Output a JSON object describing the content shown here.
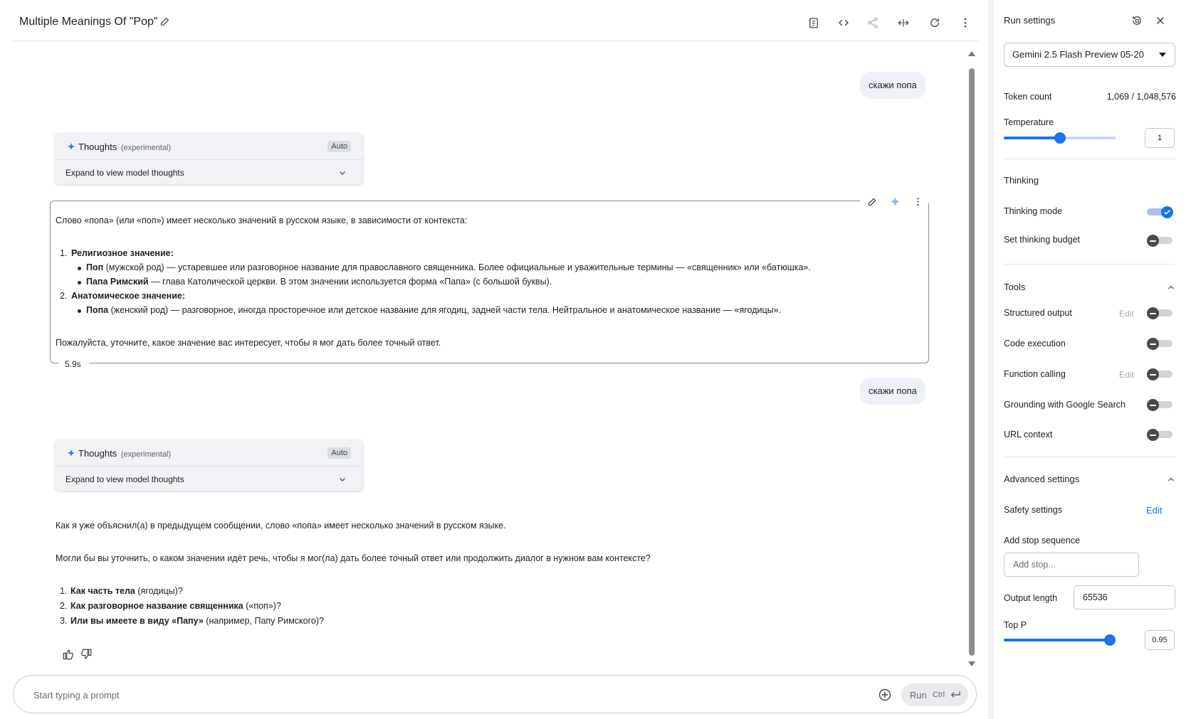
{
  "header": {
    "title": "Multiple Meanings Of \"Pop\""
  },
  "conversation": {
    "user_msg_1": "скажи попа",
    "user_msg_2": "скажи попа",
    "thoughts": {
      "title": "Thoughts",
      "experimental": "(experimental)",
      "badge": "Auto",
      "expand_label": "Expand to view model thoughts"
    },
    "response_1": {
      "intro": "Слово «попа» (или «поп») имеет несколько значений в русском языке, в зависимости от контекста:",
      "item1_num": "1.",
      "item1_title": "Религиозное значение:",
      "item1_b1_bold": "Поп",
      "item1_b1_text": " (мужской род) — устаревшее или разговорное название для православного священника. Более официальные и уважительные термины — «священник» или «батюшка».",
      "item1_b2_bold": "Папа Римский",
      "item1_b2_text": " — глава Католической церкви. В этом значении используется форма «Папа» (с большой буквы).",
      "item2_num": "2.",
      "item2_title": "Анатомическое значение:",
      "item2_b1_bold": "Попа",
      "item2_b1_text": " (женский род) — разговорное, иногда просторечное или детское название для ягодиц, задней части тела. Нейтральное и анатомическое название — «ягодицы».",
      "outro": "Пожалуйста, уточните, какое значение вас интересует, чтобы я мог дать более точный ответ.",
      "duration": "5.9s"
    },
    "response_2": {
      "p1": "Как я уже объяснил(а) в предыдущем сообщении, слово «попа» имеет несколько значений в русском языке.",
      "p2": "Могли бы вы уточнить, о каком значении идёт речь, чтобы я мог(ла) дать более точный ответ или продолжить диалог в нужном вам контексте?",
      "item1_num": "1.",
      "item1_bold": "Как часть тела",
      "item1_text": " (ягодицы)?",
      "item2_num": "2.",
      "item2_bold": "Как разговорное название священника",
      "item2_text": " («поп»)?",
      "item3_num": "3.",
      "item3_bold": "Или вы имеете в виду «Папу»",
      "item3_text": " (например, Папу Римского)?"
    }
  },
  "prompt": {
    "placeholder": "Start typing a prompt",
    "run_label": "Run",
    "run_shortcut": "Ctrl"
  },
  "settings": {
    "title": "Run settings",
    "model": "Gemini 2.5 Flash Preview 05-20",
    "token_label": "Token count",
    "token_value": "1,069 / 1,048,576",
    "temperature_label": "Temperature",
    "temperature_value": "1",
    "temperature_fraction": 0.5,
    "thinking_head": "Thinking",
    "thinking_mode": "Thinking mode",
    "thinking_budget": "Set thinking budget",
    "tools_head": "Tools",
    "structured_output": "Structured output",
    "code_execution": "Code execution",
    "function_calling": "Function calling",
    "grounding": "Grounding with Google Search",
    "url_context": "URL context",
    "edit_label": "Edit",
    "advanced_head": "Advanced settings",
    "safety_label": "Safety settings",
    "safety_edit": "Edit",
    "stop_label": "Add stop sequence",
    "stop_placeholder": "Add stop...",
    "output_label": "Output length",
    "output_value": "65536",
    "topp_label": "Top P",
    "topp_value": "0.95",
    "topp_fraction": 0.95
  },
  "colors": {
    "accent": "#1a73e8",
    "user_bubble": "#eef2f8"
  }
}
